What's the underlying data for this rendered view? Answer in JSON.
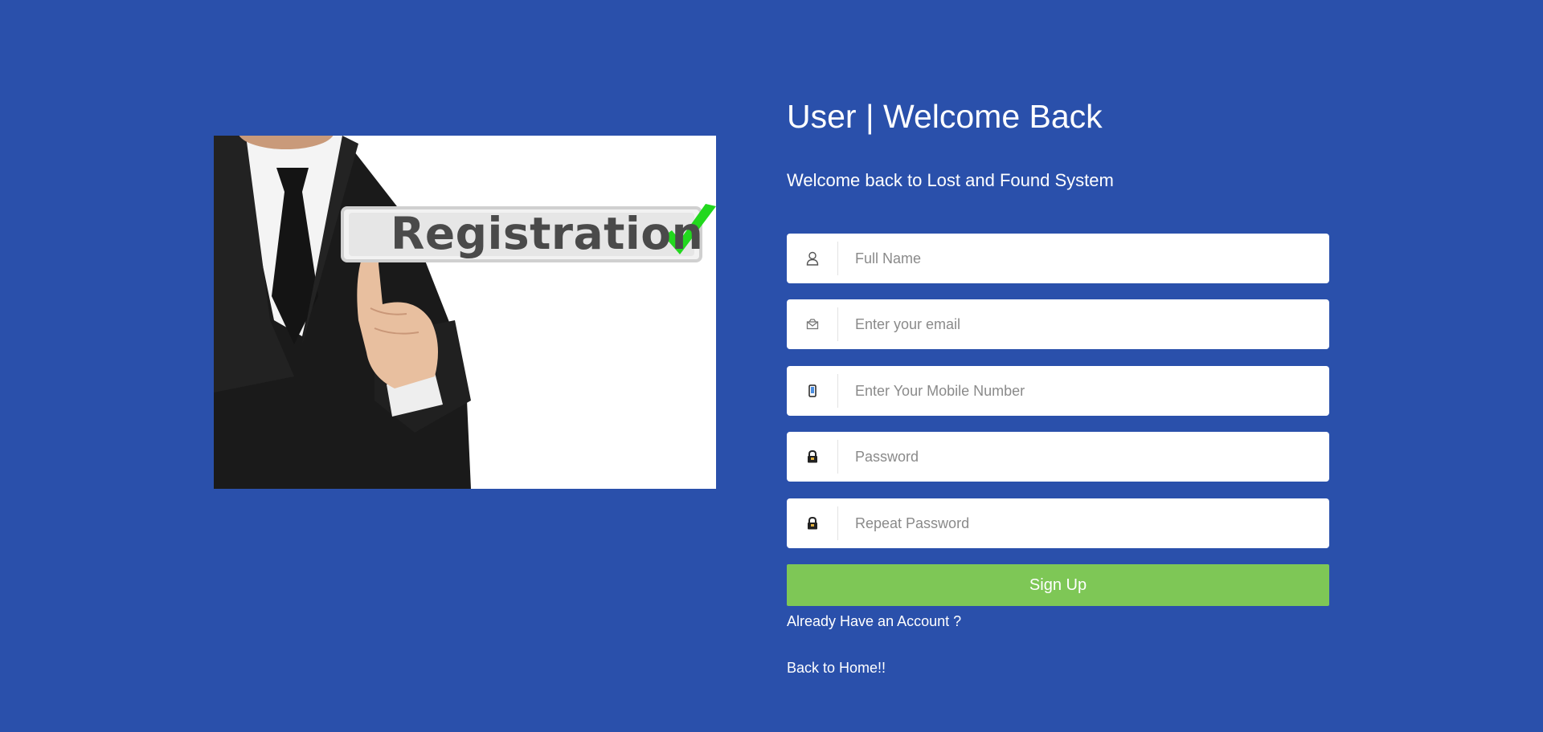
{
  "hero": {
    "banner_text": "Registration"
  },
  "header": {
    "title": "User | Welcome Back",
    "subtitle": "Welcome back to Lost and Found System"
  },
  "form": {
    "fields": [
      {
        "icon": "user-icon",
        "placeholder": "Full Name",
        "value": ""
      },
      {
        "icon": "email-icon",
        "placeholder": "Enter your email",
        "value": ""
      },
      {
        "icon": "mobile-icon",
        "placeholder": "Enter Your Mobile Number",
        "value": ""
      },
      {
        "icon": "lock-icon",
        "placeholder": "Password",
        "value": ""
      },
      {
        "icon": "lock-icon",
        "placeholder": "Repeat Password",
        "value": ""
      }
    ],
    "submit_label": "Sign Up"
  },
  "links": {
    "account": "Already Have an Account ?",
    "home": "Back to Home!!"
  },
  "colors": {
    "background": "#2a50ab",
    "button": "#7ec756",
    "checkmark": "#22d81e"
  }
}
